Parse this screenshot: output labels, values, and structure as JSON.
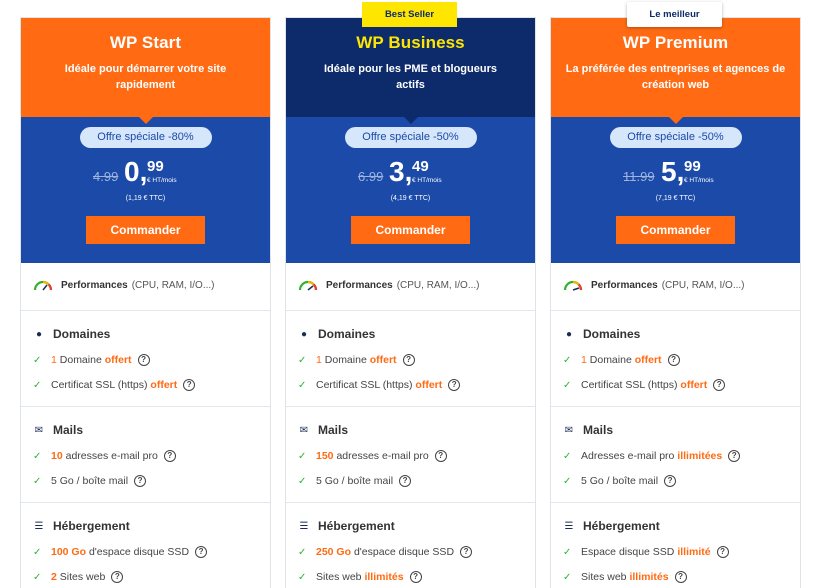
{
  "badges": {
    "best_seller": "Best Seller",
    "le_meilleur": "Le meilleur"
  },
  "colors": {
    "orange": "#ff6a13",
    "navy": "#0d2a6b",
    "blue": "#1c4aa8",
    "yellow": "#ffe600",
    "green": "#2fb32f"
  },
  "plans": [
    {
      "name": "WP Start",
      "description": "Idéale pour démarrer votre site rapidement",
      "offer": "Offre spéciale -80%",
      "old_price": "4.99",
      "price_int": "0,",
      "price_dec": "99",
      "price_unit": "€ HT/mois",
      "price_ttc": "(1,19 € TTC)",
      "order_label": "Commander",
      "performances": {
        "label": "Performances",
        "detail": "(CPU, RAM, I/O...)"
      },
      "domaines": {
        "title": "Domaines",
        "f1_value": "1",
        "f1_text": "Domaine",
        "f1_hl": "offert",
        "f2_text": "Certificat SSL (https)",
        "f2_hl": "offert"
      },
      "mails": {
        "title": "Mails",
        "f1_value": "10",
        "f1_text": "adresses e-mail pro",
        "f2_text": "5 Go / boîte mail"
      },
      "hebergement": {
        "title": "Hébergement",
        "f1_value": "100 Go",
        "f1_text": "d'espace disque SSD",
        "f2_value": "2",
        "f2_text": "Sites web"
      }
    },
    {
      "name": "WP Business",
      "description": "Idéale pour les PME et blogueurs actifs",
      "offer": "Offre spéciale -50%",
      "old_price": "6.99",
      "price_int": "3,",
      "price_dec": "49",
      "price_unit": "€ HT/mois",
      "price_ttc": "(4,19 € TTC)",
      "order_label": "Commander",
      "performances": {
        "label": "Performances",
        "detail": "(CPU, RAM, I/O...)"
      },
      "domaines": {
        "title": "Domaines",
        "f1_value": "1",
        "f1_text": "Domaine",
        "f1_hl": "offert",
        "f2_text": "Certificat SSL (https)",
        "f2_hl": "offert"
      },
      "mails": {
        "title": "Mails",
        "f1_value": "150",
        "f1_text": "adresses e-mail pro",
        "f2_text": "5 Go / boîte mail"
      },
      "hebergement": {
        "title": "Hébergement",
        "f1_value": "250 Go",
        "f1_text": "d'espace disque SSD",
        "f2_text": "Sites web",
        "f2_hl": "illimités"
      }
    },
    {
      "name": "WP Premium",
      "description": "La préférée des entreprises et agences de création web",
      "offer": "Offre spéciale -50%",
      "old_price": "11.99",
      "price_int": "5,",
      "price_dec": "99",
      "price_unit": "€ HT/mois",
      "price_ttc": "(7,19 € TTC)",
      "order_label": "Commander",
      "performances": {
        "label": "Performances",
        "detail": "(CPU, RAM, I/O...)"
      },
      "domaines": {
        "title": "Domaines",
        "f1_value": "1",
        "f1_text": "Domaine",
        "f1_hl": "offert",
        "f2_text": "Certificat SSL (https)",
        "f2_hl": "offert"
      },
      "mails": {
        "title": "Mails",
        "f1_text": "Adresses e-mail pro",
        "f1_hl": "illimitées",
        "f2_text": "5 Go / boîte mail"
      },
      "hebergement": {
        "title": "Hébergement",
        "f1_text": "Espace disque SSD",
        "f1_hl": "illimité",
        "f2_text": "Sites web",
        "f2_hl": "illimités"
      }
    }
  ],
  "icons": {
    "performances": "speedometer-icon",
    "domaines": "globe-icon",
    "mails": "envelope-icon",
    "hebergement": "server-icon",
    "check": "check-icon",
    "help": "help-icon"
  }
}
